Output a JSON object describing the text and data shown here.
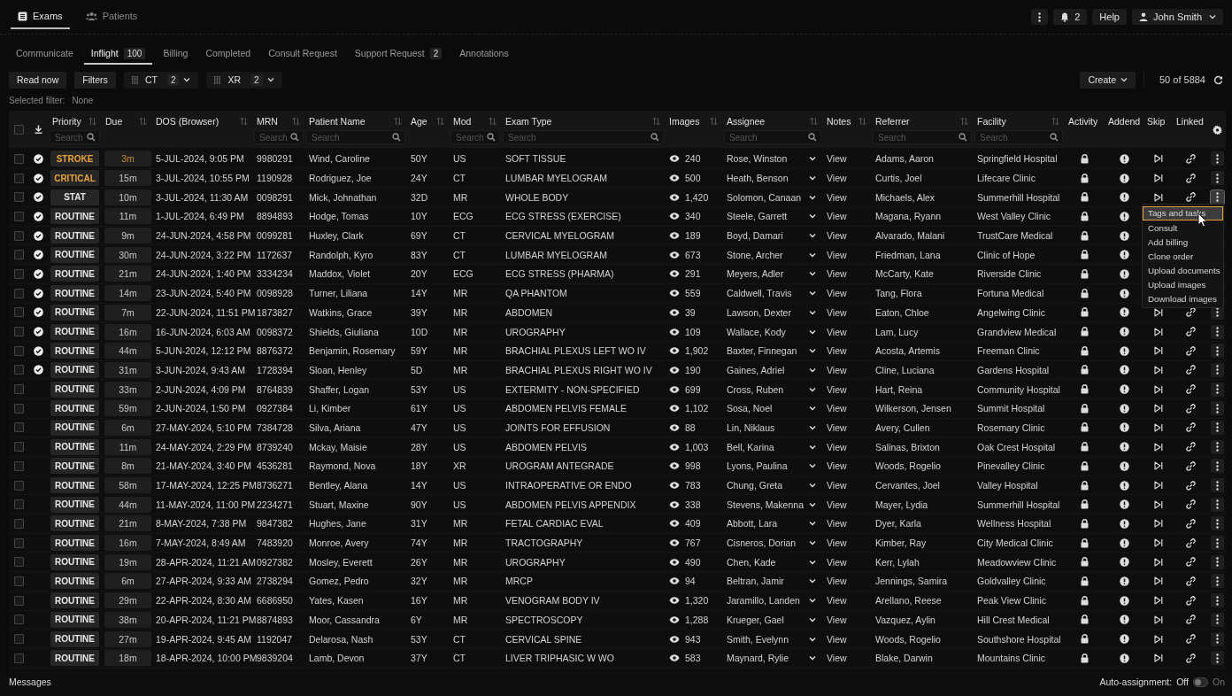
{
  "app_tabs": [
    {
      "label": "Exams",
      "selected": true
    },
    {
      "label": "Patients",
      "selected": false
    }
  ],
  "top_actions": {
    "notifications": "2",
    "help": "Help",
    "user": "John Smith"
  },
  "worklist_tabs": [
    {
      "label": "Communicate",
      "selected": false
    },
    {
      "label": "Inflight",
      "count": "100",
      "selected": true
    },
    {
      "label": "Billing",
      "selected": false
    },
    {
      "label": "Completed",
      "selected": false
    },
    {
      "label": "Consult Request",
      "selected": false
    },
    {
      "label": "Support Request",
      "count": "2",
      "selected": false
    },
    {
      "label": "Annotations",
      "selected": false
    }
  ],
  "toolbar": {
    "buttons": [
      "Read now",
      "Filters"
    ],
    "modality_filters": [
      {
        "label": "CT",
        "count": "2"
      },
      {
        "label": "XR",
        "count": "2"
      }
    ],
    "create": "Create",
    "result_count": "50 of 5884"
  },
  "selected_filter": {
    "label": "Selected filter:",
    "value": "None"
  },
  "table": {
    "select_all": {
      "checked": false
    },
    "columns": [
      {
        "label": "Priority",
        "sortable": true,
        "placeholder": "Search"
      },
      {
        "label": "Due",
        "sortable": true
      },
      {
        "label": "DOS (Browser)",
        "sortable": true
      },
      {
        "label": "MRN",
        "sortable": true,
        "placeholder": "Search"
      },
      {
        "label": "Patient Name",
        "sortable": true,
        "placeholder": "Search"
      },
      {
        "label": "Age",
        "sortable": true
      },
      {
        "label": "Mod",
        "sortable": true,
        "placeholder": "Search"
      },
      {
        "label": "Exam Type",
        "sortable": true,
        "placeholder": "Search"
      },
      {
        "label": "Images",
        "sortable": true
      },
      {
        "label": "Assignee",
        "sortable": true,
        "placeholder": "Search"
      },
      {
        "label": "Notes",
        "sortable": true
      },
      {
        "label": "Referrer",
        "sortable": true,
        "placeholder": "Search"
      },
      {
        "label": "Facility",
        "sortable": true,
        "placeholder": "Search"
      },
      {
        "label": "Activity",
        "sortable": false
      },
      {
        "label": "Addend",
        "sortable": false
      },
      {
        "label": "Skip",
        "sortable": false
      },
      {
        "label": "Linked",
        "sortable": false
      }
    ],
    "rows": [
      {
        "selected": false,
        "verified": true,
        "priority": "STROKE",
        "priority_alert": true,
        "due": "3m",
        "due_alert": true,
        "dos": "5-JUL-2024, 9:05 PM",
        "mrn": "9980291",
        "patient": "Wind, Caroline",
        "age": "50Y",
        "mod": "US",
        "exam": "SOFT TISSUE",
        "images": "240",
        "assignee": "Rose, Winston",
        "notes": "View",
        "referrer": "Adams, Aaron",
        "facility": "Springfield Hospital",
        "menu_open": false
      },
      {
        "selected": false,
        "verified": true,
        "priority": "CRITICAL",
        "priority_alert": true,
        "due": "15m",
        "due_alert": false,
        "dos": "3-JUL-2024, 10:55 PM",
        "mrn": "1190928",
        "patient": "Rodriguez, Joe",
        "age": "24Y",
        "mod": "CT",
        "exam": "LUMBAR MYELOGRAM",
        "images": "500",
        "assignee": "Heath, Benson",
        "notes": "View",
        "referrer": "Curtis, Joel",
        "facility": "Lifecare Clinic",
        "menu_open": false
      },
      {
        "selected": false,
        "verified": true,
        "priority": "STAT",
        "priority_alert": false,
        "due": "10m",
        "due_alert": false,
        "dos": "3-JUL-2024, 11:30 AM",
        "mrn": "0098291",
        "patient": "Mick, Johnathan",
        "age": "32D",
        "mod": "MR",
        "exam": "WHOLE BODY",
        "images": "1,420",
        "assignee": "Solomon, Canaan",
        "notes": "View",
        "referrer": "Michaels, Alex",
        "facility": "Summerhill Hospital",
        "menu_open": true
      },
      {
        "selected": false,
        "verified": true,
        "priority": "ROUTINE",
        "priority_alert": false,
        "due": "11m",
        "due_alert": false,
        "dos": "1-JUL-2024, 6:49 PM",
        "mrn": "8894893",
        "patient": "Hodge, Tomas",
        "age": "10Y",
        "mod": "ECG",
        "exam": "ECG STRESS (EXERCISE)",
        "images": "340",
        "assignee": "Steele, Garrett",
        "notes": "View",
        "referrer": "Magana, Ryann",
        "facility": "West Valley Clinic",
        "menu_open": false
      },
      {
        "selected": false,
        "verified": true,
        "priority": "ROUTINE",
        "priority_alert": false,
        "due": "9m",
        "due_alert": false,
        "dos": "24-JUN-2024, 4:58 PM",
        "mrn": "0099281",
        "patient": "Huxley, Clark",
        "age": "69Y",
        "mod": "CT",
        "exam": "CERVICAL MYELOGRAM",
        "images": "189",
        "assignee": "Boyd, Damari",
        "notes": "View",
        "referrer": "Alvarado, Malani",
        "facility": "TrustCare Medical",
        "menu_open": false
      },
      {
        "selected": false,
        "verified": true,
        "priority": "ROUTINE",
        "priority_alert": false,
        "due": "30m",
        "due_alert": false,
        "dos": "24-JUN-2024, 3:22 PM",
        "mrn": "1172637",
        "patient": "Randolph, Kyro",
        "age": "83Y",
        "mod": "CT",
        "exam": "LUMBAR MYELOGRAM",
        "images": "673",
        "assignee": "Stone, Archer",
        "notes": "View",
        "referrer": "Friedman, Lana",
        "facility": "Clinic of Hope",
        "menu_open": false
      },
      {
        "selected": false,
        "verified": true,
        "priority": "ROUTINE",
        "priority_alert": false,
        "due": "21m",
        "due_alert": false,
        "dos": "24-JUN-2024, 1:40 PM",
        "mrn": "3334234",
        "patient": "Maddox, Violet",
        "age": "20Y",
        "mod": "ECG",
        "exam": "ECG STRESS (PHARMA)",
        "images": "291",
        "assignee": "Meyers, Adler",
        "notes": "View",
        "referrer": "McCarty, Kate",
        "facility": "Riverside Clinic",
        "menu_open": false
      },
      {
        "selected": false,
        "verified": true,
        "priority": "ROUTINE",
        "priority_alert": false,
        "due": "14m",
        "due_alert": false,
        "dos": "23-JUN-2024, 5:40 PM",
        "mrn": "0098928",
        "patient": "Turner, Liliana",
        "age": "14Y",
        "mod": "MR",
        "exam": "QA PHANTOM",
        "images": "559",
        "assignee": "Caldwell, Travis",
        "notes": "View",
        "referrer": "Tang, Flora",
        "facility": "Fortuna Medical",
        "menu_open": false
      },
      {
        "selected": false,
        "verified": true,
        "priority": "ROUTINE",
        "priority_alert": false,
        "due": "7m",
        "due_alert": false,
        "dos": "22-JUN-2024, 11:51 PM",
        "mrn": "1873827",
        "patient": "Watkins, Grace",
        "age": "39Y",
        "mod": "MR",
        "exam": "ABDOMEN",
        "images": "39",
        "assignee": "Lawson, Dexter",
        "notes": "View",
        "referrer": "Eaton, Chloe",
        "facility": "Angelwing Clinic",
        "menu_open": false
      },
      {
        "selected": false,
        "verified": true,
        "priority": "ROUTINE",
        "priority_alert": false,
        "due": "16m",
        "due_alert": false,
        "dos": "16-JUN-2024, 6:03 AM",
        "mrn": "0098372",
        "patient": "Shields, Giuliana",
        "age": "10D",
        "mod": "MR",
        "exam": "UROGRAPHY",
        "images": "109",
        "assignee": "Wallace, Kody",
        "notes": "View",
        "referrer": "Lam, Lucy",
        "facility": "Grandview Medical",
        "menu_open": false
      },
      {
        "selected": false,
        "verified": true,
        "priority": "ROUTINE",
        "priority_alert": false,
        "due": "44m",
        "due_alert": false,
        "dos": "5-JUN-2024, 12:12 PM",
        "mrn": "8876372",
        "patient": "Benjamin, Rosemary",
        "age": "59Y",
        "mod": "MR",
        "exam": "BRACHIAL PLEXUS LEFT WO IV",
        "images": "1,902",
        "assignee": "Baxter, Finnegan",
        "notes": "View",
        "referrer": "Acosta, Artemis",
        "facility": "Freeman Clinic",
        "menu_open": false
      },
      {
        "selected": false,
        "verified": true,
        "priority": "ROUTINE",
        "priority_alert": false,
        "due": "31m",
        "due_alert": false,
        "dos": "3-JUN-2024, 9:43 AM",
        "mrn": "1728394",
        "patient": "Sloan, Henley",
        "age": "5D",
        "mod": "MR",
        "exam": "BRACHIAL PLEXUS RIGHT WO IV",
        "images": "190",
        "assignee": "Gaines, Adriel",
        "notes": "View",
        "referrer": "Cline, Luciana",
        "facility": "Gardens Hospital",
        "menu_open": false
      },
      {
        "selected": false,
        "verified": false,
        "priority": "ROUTINE",
        "priority_alert": false,
        "due": "33m",
        "due_alert": false,
        "dos": "2-JUN-2024, 4:09 PM",
        "mrn": "8764839",
        "patient": "Shaffer, Logan",
        "age": "53Y",
        "mod": "US",
        "exam": "EXTERMITY - NON-SPECIFIED",
        "images": "699",
        "assignee": "Cross, Ruben",
        "notes": "View",
        "referrer": "Hart, Reina",
        "facility": "Community Hospital",
        "menu_open": false
      },
      {
        "selected": false,
        "verified": false,
        "priority": "ROUTINE",
        "priority_alert": false,
        "due": "59m",
        "due_alert": false,
        "dos": "2-JUN-2024, 1:50 PM",
        "mrn": "0927384",
        "patient": "Li, Kimber",
        "age": "61Y",
        "mod": "US",
        "exam": "ABDOMEN PELVIS FEMALE",
        "images": "1,102",
        "assignee": "Sosa, Noel",
        "notes": "View",
        "referrer": "Wilkerson, Jensen",
        "facility": "Summit Hospital",
        "menu_open": false
      },
      {
        "selected": false,
        "verified": false,
        "priority": "ROUTINE",
        "priority_alert": false,
        "due": "6m",
        "due_alert": false,
        "dos": "27-MAY-2024, 5:10 PM",
        "mrn": "7384728",
        "patient": "Silva, Ariana",
        "age": "47Y",
        "mod": "US",
        "exam": "JOINTS FOR EFFUSION",
        "images": "88",
        "assignee": "Lin, Niklaus",
        "notes": "View",
        "referrer": "Avery, Cullen",
        "facility": "Rosemary Clinic",
        "menu_open": false
      },
      {
        "selected": false,
        "verified": false,
        "priority": "ROUTINE",
        "priority_alert": false,
        "due": "11m",
        "due_alert": false,
        "dos": "24-MAY-2024, 2:29 PM",
        "mrn": "8739240",
        "patient": "Mckay, Maisie",
        "age": "28Y",
        "mod": "US",
        "exam": "ABDOMEN PELVIS",
        "images": "1,003",
        "assignee": "Bell, Karina",
        "notes": "View",
        "referrer": "Salinas, Brixton",
        "facility": "Oak Crest Hospital",
        "menu_open": false
      },
      {
        "selected": false,
        "verified": false,
        "priority": "ROUTINE",
        "priority_alert": false,
        "due": "8m",
        "due_alert": false,
        "dos": "21-MAY-2024, 3:40 PM",
        "mrn": "4536281",
        "patient": "Raymond, Nova",
        "age": "18Y",
        "mod": "XR",
        "exam": "UROGRAM ANTEGRADE",
        "images": "998",
        "assignee": "Lyons, Paulina",
        "notes": "View",
        "referrer": "Woods, Rogelio",
        "facility": "Pinevalley Clinic",
        "menu_open": false
      },
      {
        "selected": false,
        "verified": false,
        "priority": "ROUTINE",
        "priority_alert": false,
        "due": "58m",
        "due_alert": false,
        "dos": "17-MAY-2024, 12:25 PM",
        "mrn": "8736271",
        "patient": "Bentley, Alana",
        "age": "14Y",
        "mod": "US",
        "exam": "INTRAOPERATIVE OR ENDO",
        "images": "783",
        "assignee": "Chung, Greta",
        "notes": "View",
        "referrer": "Cervantes, Joel",
        "facility": "Valley Hospital",
        "menu_open": false
      },
      {
        "selected": false,
        "verified": false,
        "priority": "ROUTINE",
        "priority_alert": false,
        "due": "44m",
        "due_alert": false,
        "dos": "11-MAY-2024, 11:00 PM",
        "mrn": "2234271",
        "patient": "Stuart, Maxine",
        "age": "90Y",
        "mod": "US",
        "exam": "ABDOMEN PELVIS APPENDIX",
        "images": "338",
        "assignee": "Stevens, Makenna",
        "notes": "View",
        "referrer": "Mayer, Lydia",
        "facility": "Summerhill Hospital",
        "menu_open": false
      },
      {
        "selected": false,
        "verified": false,
        "priority": "ROUTINE",
        "priority_alert": false,
        "due": "21m",
        "due_alert": false,
        "dos": "8-MAY-2024, 7:38 PM",
        "mrn": "9847382",
        "patient": "Hughes, Jane",
        "age": "31Y",
        "mod": "MR",
        "exam": "FETAL CARDIAC EVAL",
        "images": "409",
        "assignee": "Abbott, Lara",
        "notes": "View",
        "referrer": "Dyer, Karla",
        "facility": "Wellness Hospital",
        "menu_open": false
      },
      {
        "selected": false,
        "verified": false,
        "priority": "ROUTINE",
        "priority_alert": false,
        "due": "16m",
        "due_alert": false,
        "dos": "7-MAY-2024, 8:49 AM",
        "mrn": "7483920",
        "patient": "Monroe, Avery",
        "age": "74Y",
        "mod": "MR",
        "exam": "TRACTOGRAPHY",
        "images": "767",
        "assignee": "Cisneros, Dorian",
        "notes": "View",
        "referrer": "Kimber, Ray",
        "facility": "City Medical Clinic",
        "menu_open": false
      },
      {
        "selected": false,
        "verified": false,
        "priority": "ROUTINE",
        "priority_alert": false,
        "due": "19m",
        "due_alert": false,
        "dos": "28-APR-2024, 11:21 AM",
        "mrn": "0927382",
        "patient": "Mosley, Everett",
        "age": "26Y",
        "mod": "MR",
        "exam": "UROGRAPHY",
        "images": "490",
        "assignee": "Chen, Kade",
        "notes": "View",
        "referrer": "Kerr, Lylah",
        "facility": "Meadowview Clinic",
        "menu_open": false
      },
      {
        "selected": false,
        "verified": false,
        "priority": "ROUTINE",
        "priority_alert": false,
        "due": "6m",
        "due_alert": false,
        "dos": "27-APR-2024, 9:33 AM",
        "mrn": "2738294",
        "patient": "Gomez, Pedro",
        "age": "32Y",
        "mod": "MR",
        "exam": "MRCP",
        "images": "94",
        "assignee": "Beltran, Jamir",
        "notes": "View",
        "referrer": "Jennings, Samira",
        "facility": "Goldvalley Clinic",
        "menu_open": false
      },
      {
        "selected": false,
        "verified": false,
        "priority": "ROUTINE",
        "priority_alert": false,
        "due": "29m",
        "due_alert": false,
        "dos": "22-APR-2024, 8:30 AM",
        "mrn": "6686950",
        "patient": "Yates, Kasen",
        "age": "16Y",
        "mod": "MR",
        "exam": "VENOGRAM BODY IV",
        "images": "1,320",
        "assignee": "Jaramillo, Landen",
        "notes": "View",
        "referrer": "Arellano, Reese",
        "facility": "Peak View Clinic",
        "menu_open": false
      },
      {
        "selected": false,
        "verified": false,
        "priority": "ROUTINE",
        "priority_alert": false,
        "due": "38m",
        "due_alert": false,
        "dos": "20-APR-2024, 11:21 PM",
        "mrn": "8874893",
        "patient": "Moor, Cassandra",
        "age": "6Y",
        "mod": "MR",
        "exam": "SPECTROSCOPY",
        "images": "1,288",
        "assignee": "Krueger, Gael",
        "notes": "View",
        "referrer": "Vazquez, Aylin",
        "facility": "Hill Crest Medical",
        "menu_open": false
      },
      {
        "selected": false,
        "verified": false,
        "priority": "ROUTINE",
        "priority_alert": false,
        "due": "27m",
        "due_alert": false,
        "dos": "19-APR-2024, 9:45 AM",
        "mrn": "1192047",
        "patient": "Delarosa, Nash",
        "age": "53Y",
        "mod": "CT",
        "exam": "CERVICAL SPINE",
        "images": "943",
        "assignee": "Smith, Evelynn",
        "notes": "View",
        "referrer": "Woods, Rogelio",
        "facility": "Southshore Hospital",
        "menu_open": false
      },
      {
        "selected": false,
        "verified": false,
        "priority": "ROUTINE",
        "priority_alert": false,
        "due": "18m",
        "due_alert": false,
        "dos": "18-APR-2024, 10:00 PM",
        "mrn": "9839204",
        "patient": "Lamb, Devon",
        "age": "37Y",
        "mod": "CT",
        "exam": "LIVER TRIPHASIC W WO",
        "images": "583",
        "assignee": "Maynard, Rylie",
        "notes": "View",
        "referrer": "Blake, Darwin",
        "facility": "Mountains Clinic",
        "menu_open": false
      }
    ]
  },
  "row_menu": [
    {
      "label": "Tags and tasks",
      "selected": true
    },
    {
      "label": "Consult",
      "selected": false
    },
    {
      "label": "Add billing",
      "selected": false
    },
    {
      "label": "Clone order",
      "selected": false
    },
    {
      "label": "Upload documents",
      "selected": false
    },
    {
      "label": "Upload images",
      "selected": false
    },
    {
      "label": "Download images",
      "selected": false
    }
  ],
  "footer": {
    "messages": "Messages",
    "auto_assignment": {
      "label": "Auto-assignment:",
      "off_label": "Off",
      "on_label": "On",
      "on": false
    }
  }
}
